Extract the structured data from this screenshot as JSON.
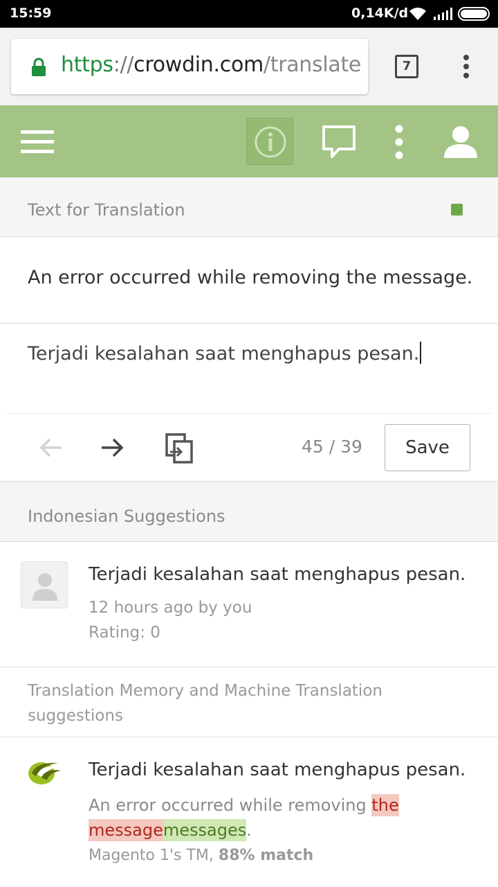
{
  "status_bar": {
    "time": "15:59",
    "network_speed": "0,14K/d"
  },
  "browser": {
    "url_scheme": "https",
    "url_separator": "://",
    "url_host": "crowdin.com",
    "url_path": "/translate",
    "tab_count": "7"
  },
  "app_header": {
    "icons": [
      "menu-icon",
      "info-icon",
      "comment-icon",
      "more-vertical-icon",
      "user-icon"
    ],
    "accent_color": "#a3c484"
  },
  "editor": {
    "section_title": "Text for Translation",
    "status_color": "#6ea84a",
    "source_text": "An error occurred while removing the message.",
    "translation_text": "Terjadi kesalahan saat menghapus pesan.",
    "counter": "45 / 39",
    "save_label": "Save"
  },
  "suggestions": {
    "section_title": "Indonesian Suggestions",
    "items": [
      {
        "text": "Terjadi kesalahan saat menghapus pesan.",
        "time": "12 hours ago by you",
        "rating": "Rating: 0"
      }
    ]
  },
  "tm": {
    "section_title": "Translation Memory and Machine Translation suggestions",
    "items": [
      {
        "text": "Terjadi kesalahan saat menghapus pesan.",
        "source_plain": "An error occurred while removing ",
        "source_deleted_1": "the",
        "source_deleted_2": "message",
        "source_inserted": "messages",
        "source_end": ".",
        "source_name": "Magento 1's TM, ",
        "match": "88% match"
      }
    ]
  }
}
